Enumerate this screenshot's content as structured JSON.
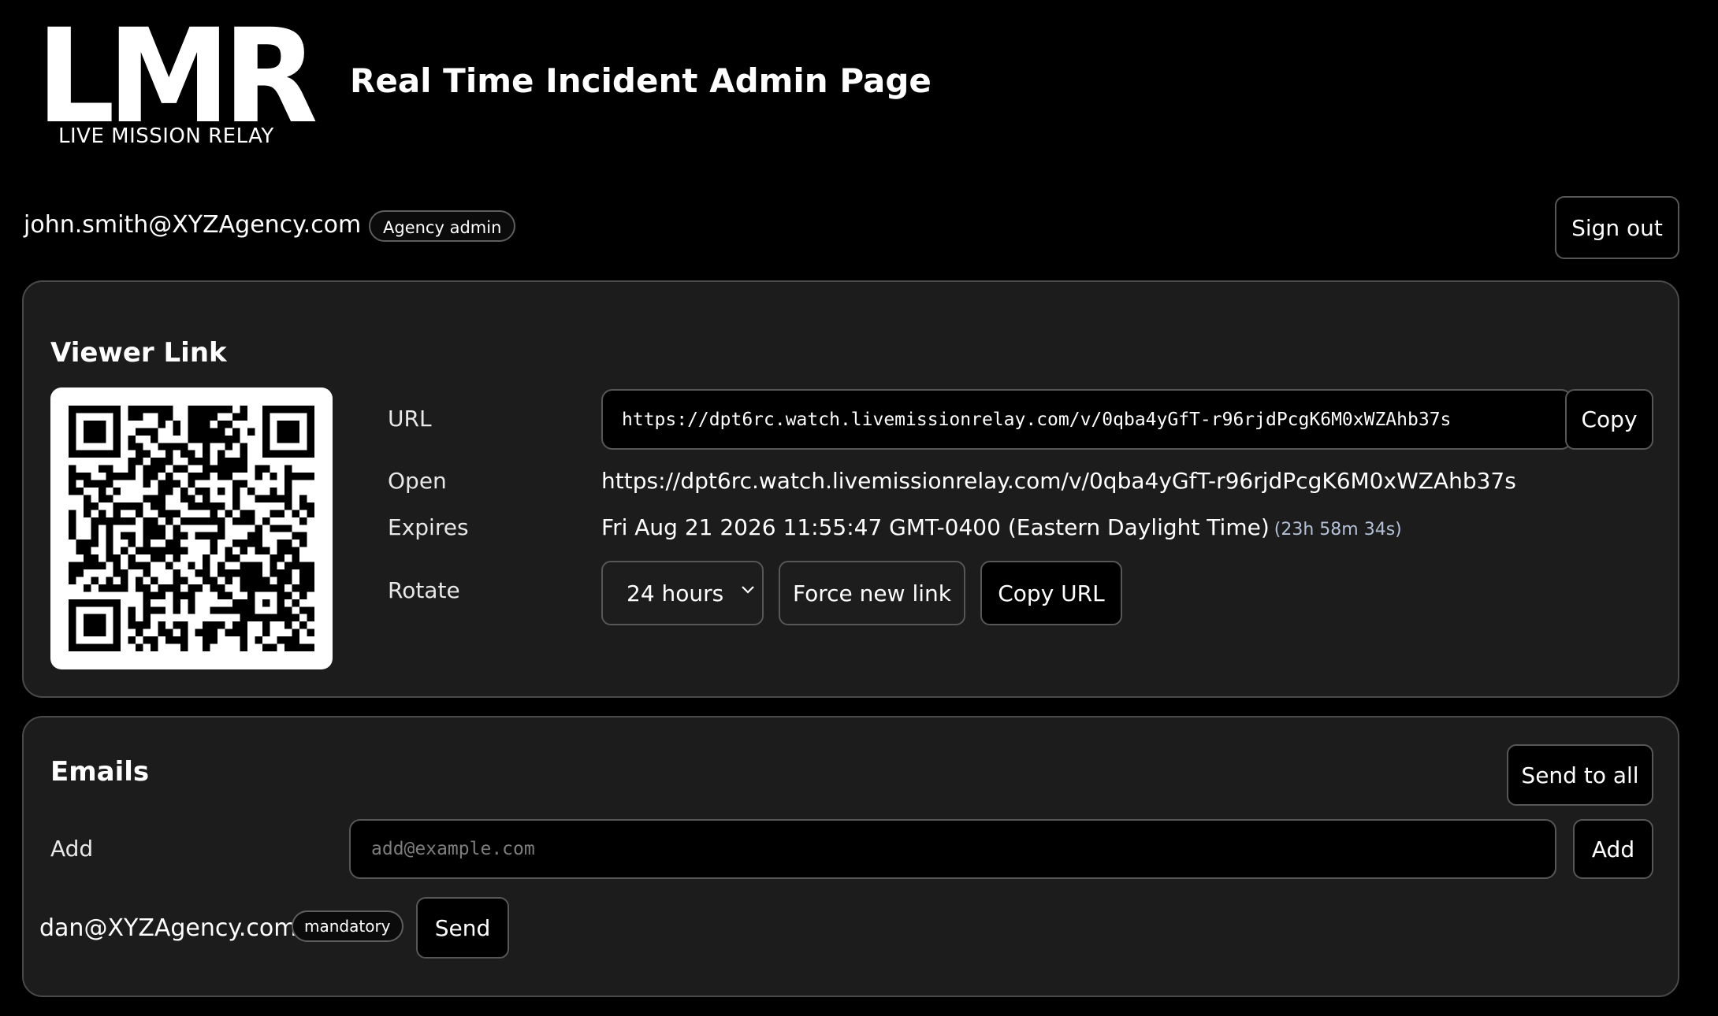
{
  "logo": {
    "mark": "LMR",
    "tagline": "LIVE MISSION RELAY"
  },
  "header": {
    "title": "Real Time Incident Admin Page"
  },
  "user": {
    "email": "john.smith@XYZAgency.com",
    "role": "Agency admin",
    "signout_label": "Sign out"
  },
  "viewer_link": {
    "title": "Viewer Link",
    "url_label": "URL",
    "url_value": "https://dpt6rc.watch.livemissionrelay.com/v/0qba4yGfT-r96rjdPcgK6M0xWZAhb37s",
    "copy_label": "Copy",
    "open_label": "Open",
    "open_link": "https://dpt6rc.watch.livemissionrelay.com/v/0qba4yGfT-r96rjdPcgK6M0xWZAhb37s",
    "expires_label": "Expires",
    "expires_value": "Fri Aug 21 2026 11:55:47 GMT-0400 (Eastern Daylight Time)",
    "expires_countdown": "(23h 58m 34s)",
    "rotate_label": "Rotate",
    "rotate_selected": "24 hours",
    "force_new_label": "Force new link",
    "copy_url_label": "Copy URL"
  },
  "emails": {
    "title": "Emails",
    "send_all_label": "Send to all",
    "add_label": "Add",
    "add_placeholder": "add@example.com",
    "add_button_label": "Add",
    "recipients": [
      {
        "email": "dan@XYZAgency.com",
        "tag": "mandatory",
        "send_label": "Send"
      }
    ]
  },
  "colors": {
    "background": "#000000",
    "panel": "#1c1c1c",
    "border": "#575757",
    "countdown": "#b4c0d6"
  },
  "icons": {
    "rotate_select": "chevron-down-icon",
    "qr": "qr-code"
  }
}
